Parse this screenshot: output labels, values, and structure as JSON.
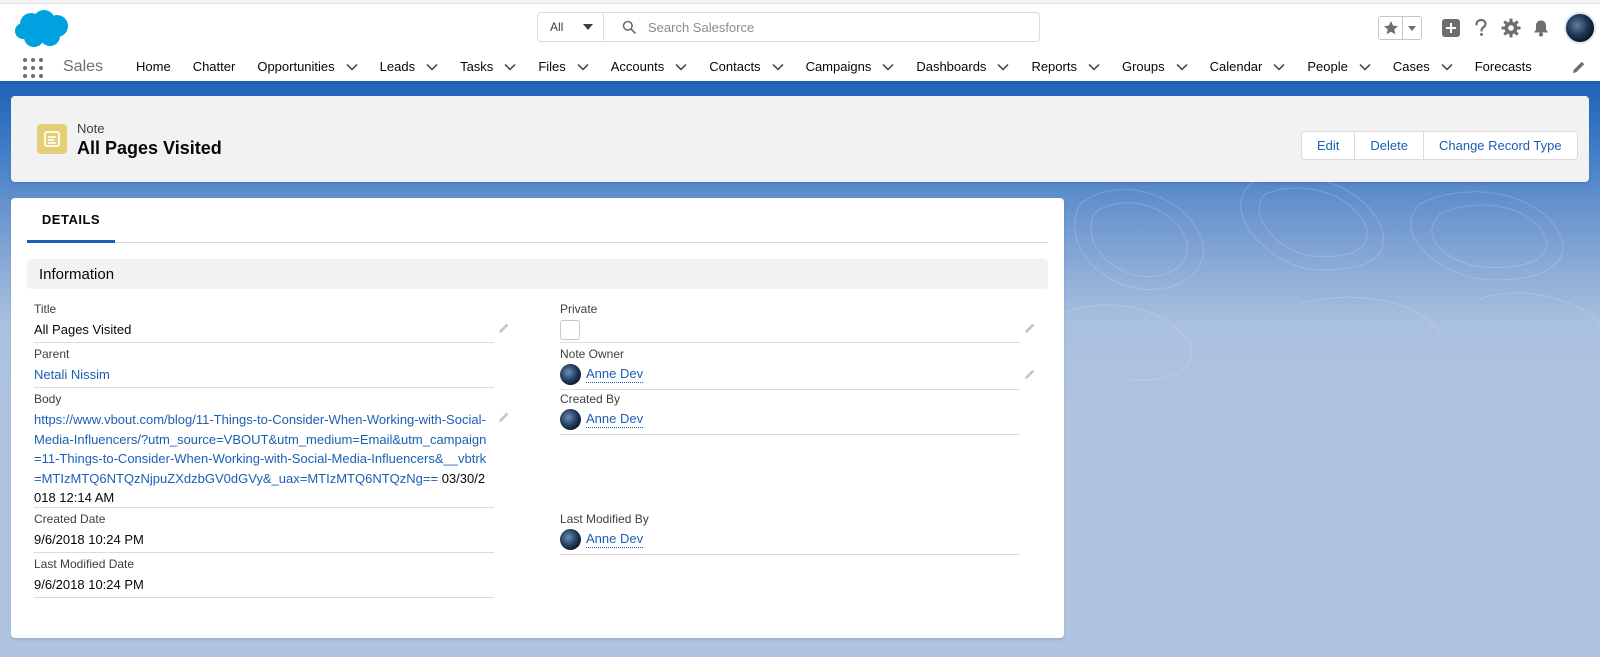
{
  "header": {
    "search": {
      "scope": "All",
      "placeholder": "Search Salesforce"
    }
  },
  "nav": {
    "app_name": "Sales",
    "items": [
      {
        "label": "Home",
        "dropdown": false
      },
      {
        "label": "Chatter",
        "dropdown": false
      },
      {
        "label": "Opportunities",
        "dropdown": true
      },
      {
        "label": "Leads",
        "dropdown": true
      },
      {
        "label": "Tasks",
        "dropdown": true
      },
      {
        "label": "Files",
        "dropdown": true
      },
      {
        "label": "Accounts",
        "dropdown": true
      },
      {
        "label": "Contacts",
        "dropdown": true
      },
      {
        "label": "Campaigns",
        "dropdown": true
      },
      {
        "label": "Dashboards",
        "dropdown": true
      },
      {
        "label": "Reports",
        "dropdown": true
      },
      {
        "label": "Groups",
        "dropdown": true
      },
      {
        "label": "Calendar",
        "dropdown": true
      },
      {
        "label": "People",
        "dropdown": true
      },
      {
        "label": "Cases",
        "dropdown": true
      },
      {
        "label": "Forecasts",
        "dropdown": false
      }
    ]
  },
  "record": {
    "type": "Note",
    "title": "All Pages Visited",
    "actions": {
      "edit": "Edit",
      "delete": "Delete",
      "change_type": "Change Record Type"
    }
  },
  "details": {
    "tab": "DETAILS",
    "section": "Information",
    "fields": {
      "title_label": "Title",
      "title_value": "All Pages Visited",
      "private_label": "Private",
      "private_checked": false,
      "parent_label": "Parent",
      "parent_value": "Netali Nissim",
      "owner_label": "Note Owner",
      "owner_value": "Anne Dev",
      "body_label": "Body",
      "body_link": "https://www.vbout.com/blog/11-Things-to-Consider-When-Working-with-Social-Media-Influencers/?utm_source=VBOUT&utm_medium=Email&utm_campaign=11-Things-to-Consider-When-Working-with-Social-Media-Influencers&__vbtrk=MTIzMTQ6NTQzNjpuZXdzbGV0dGVy&_uax=MTIzMTQ6NTQzNg==",
      "body_suffix": " 03/30/2018 12:14 AM",
      "created_by_label": "Created By",
      "created_by_value": "Anne Dev",
      "created_date_label": "Created Date",
      "created_date_value": "9/6/2018 10:24 PM",
      "last_modified_by_label": "Last Modified By",
      "last_modified_by_value": "Anne Dev",
      "last_modified_date_label": "Last Modified Date",
      "last_modified_date_value": "9/6/2018 10:24 PM"
    }
  },
  "colors": {
    "brand": "#1b5fb4",
    "note_icon": "#e3d076",
    "salesforce_cloud": "#00a1e0"
  }
}
